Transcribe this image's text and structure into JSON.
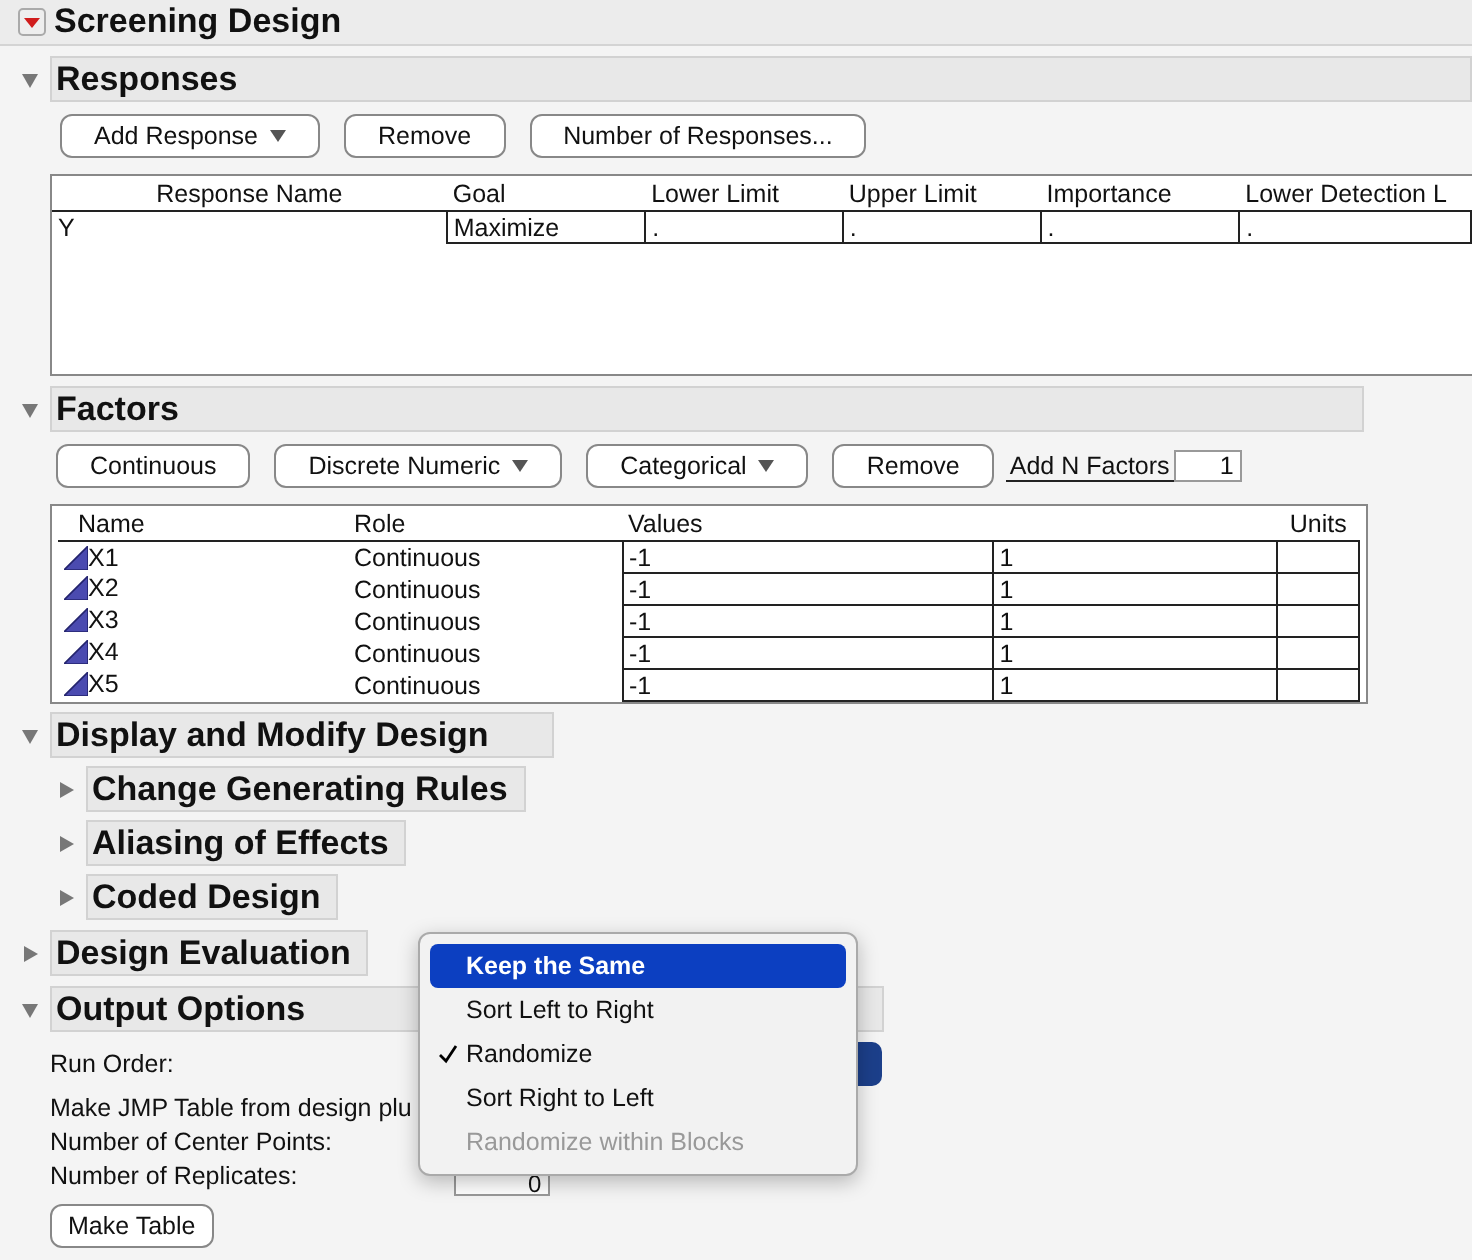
{
  "title": {
    "text": "Screening Design"
  },
  "responses": {
    "heading": "Responses",
    "expanded": true,
    "buttons": [
      {
        "label": "Add Response",
        "dropdown": true
      },
      {
        "label": "Remove",
        "dropdown": false
      },
      {
        "label": "Number of Responses...",
        "dropdown": false
      }
    ],
    "columns": [
      "Response Name",
      "Goal",
      "Lower Limit",
      "Upper Limit",
      "Importance",
      "Lower Detection L"
    ],
    "rows": [
      {
        "cells": [
          "Y",
          "Maximize",
          ".",
          ".",
          ".",
          "."
        ]
      }
    ]
  },
  "factors": {
    "heading": "Factors",
    "expanded": true,
    "buttons": [
      {
        "label": "Continuous",
        "dropdown": false
      },
      {
        "label": "Discrete Numeric",
        "dropdown": true
      },
      {
        "label": "Categorical",
        "dropdown": true
      },
      {
        "label": "Remove",
        "dropdown": false
      }
    ],
    "add_n": {
      "label": "Add N Factors",
      "value": "1"
    },
    "columns": [
      "Name",
      "Role",
      "Values",
      "Units"
    ],
    "rows": [
      {
        "name": "X1",
        "role": "Continuous",
        "low": "-1",
        "high": "1"
      },
      {
        "name": "X2",
        "role": "Continuous",
        "low": "-1",
        "high": "1"
      },
      {
        "name": "X3",
        "role": "Continuous",
        "low": "-1",
        "high": "1"
      },
      {
        "name": "X4",
        "role": "Continuous",
        "low": "-1",
        "high": "1"
      },
      {
        "name": "X5",
        "role": "Continuous",
        "low": "-1",
        "high": "1"
      }
    ]
  },
  "display": {
    "heading": "Display and Modify Design",
    "expanded": true,
    "children": [
      {
        "heading": "Change Generating Rules",
        "expanded": false
      },
      {
        "heading": "Aliasing of Effects",
        "expanded": false
      },
      {
        "heading": "Coded Design",
        "expanded": false
      }
    ]
  },
  "design_evaluation": {
    "heading": "Design Evaluation",
    "expanded": false
  },
  "output": {
    "heading": "Output Options",
    "expanded": true,
    "run_order_label": "Run Order:",
    "make_table_text": "Make JMP Table from design plu",
    "center_points_label": "Number of Center Points:",
    "replicates_label": "Number of Replicates:",
    "replicates_value": "0",
    "button": "Make Table"
  },
  "menu": {
    "items": [
      {
        "label": "Keep the Same",
        "selected": true,
        "checked": false,
        "disabled": false
      },
      {
        "label": "Sort Left to Right",
        "selected": false,
        "checked": false,
        "disabled": false
      },
      {
        "label": "Randomize",
        "selected": false,
        "checked": true,
        "disabled": false
      },
      {
        "label": "Sort Right to Left",
        "selected": false,
        "checked": false,
        "disabled": false
      },
      {
        "label": "Randomize within Blocks",
        "selected": false,
        "checked": false,
        "disabled": true
      }
    ]
  }
}
